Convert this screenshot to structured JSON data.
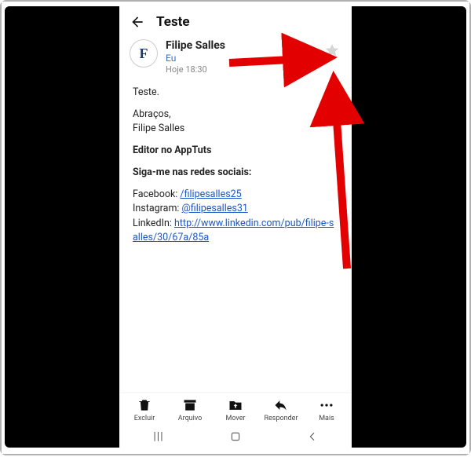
{
  "header": {
    "title": "Teste"
  },
  "sender": {
    "avatar_letter": "F",
    "name": "Filipe Salles",
    "to": "Eu",
    "time": "Hoje 18:30"
  },
  "body": {
    "greeting": "Teste.",
    "signoff1": "Abraços,",
    "signoff2": "Filipe Salles",
    "role": "Editor no AppTuts",
    "social_heading": "Siga-me nas redes sociais:",
    "facebook_label": "Facebook: ",
    "facebook_link": "/filipesalles25",
    "instagram_label": "Instagram: ",
    "instagram_link": "@filipesalles31",
    "linkedin_label": "LinkedIn: ",
    "linkedin_link": "http://www.linkedin.com/pub/filipe-salles/30/67a/85a"
  },
  "actions": {
    "delete": "Excluir",
    "archive": "Arquivo",
    "move": "Mover",
    "reply": "Responder",
    "more": "Mais"
  }
}
